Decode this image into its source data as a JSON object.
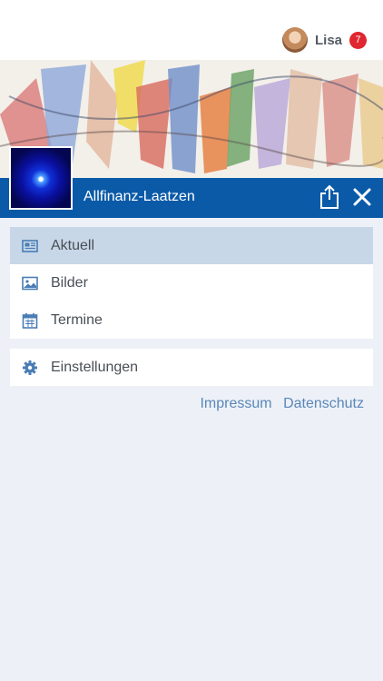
{
  "user": {
    "name": "Lisa",
    "notification_count": "7",
    "avatar_icon": "user-avatar"
  },
  "header": {
    "title": "Allfinanz-Laatzen",
    "color": "#0b5aa8",
    "share_icon": "share-icon",
    "close_icon": "close-icon"
  },
  "menu": {
    "primary": [
      {
        "label": "Aktuell",
        "icon": "newspaper-icon",
        "active": true
      },
      {
        "label": "Bilder",
        "icon": "image-icon",
        "active": false
      },
      {
        "label": "Termine",
        "icon": "calendar-icon",
        "active": false
      }
    ],
    "secondary": [
      {
        "label": "Einstellungen",
        "icon": "gear-icon",
        "active": false
      }
    ]
  },
  "footer_links": {
    "impressum": "Impressum",
    "datenschutz": "Datenschutz"
  },
  "colors": {
    "accent": "#0b5aa8",
    "active_item": "#c7d7e8",
    "badge": "#e0262e",
    "icon": "#4a7db5",
    "link": "#5a87b8"
  }
}
